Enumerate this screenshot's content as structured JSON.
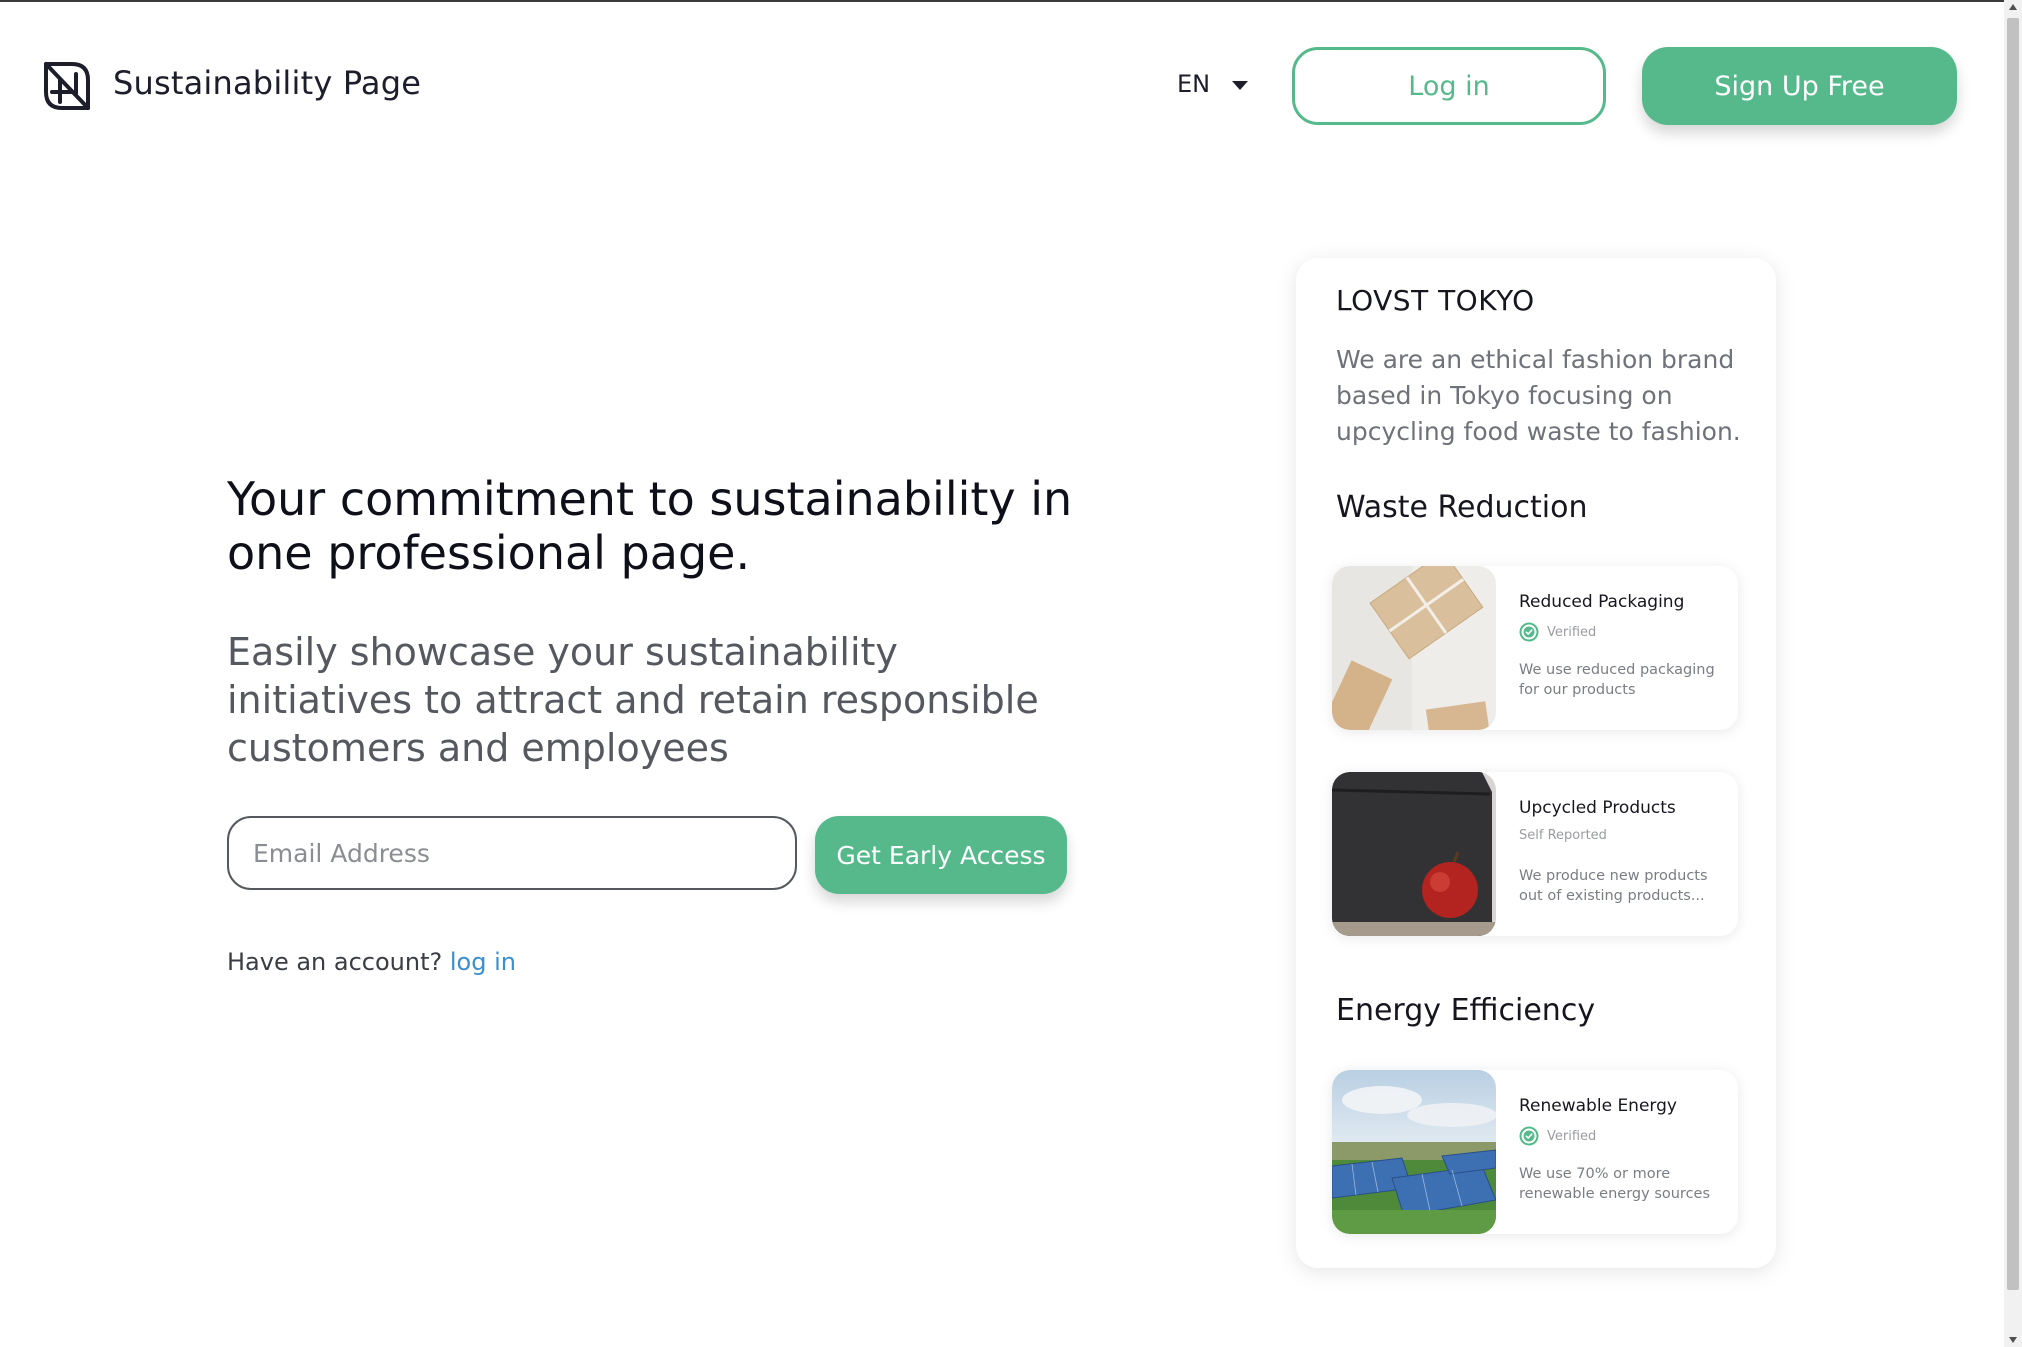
{
  "header": {
    "brand": "Sustainability Page",
    "logo_icon": "leaf-logo-icon",
    "language": "EN",
    "login_label": "Log in",
    "signup_label": "Sign Up Free"
  },
  "hero": {
    "headline": "Your commitment to sustainability in one professional page.",
    "subheadline": "Easily showcase your sustainability initiatives to attract and retain responsible customers and employees",
    "email_placeholder": "Email Address",
    "cta_label": "Get Early Access",
    "account_prompt": "Have an account?",
    "account_link": "log in"
  },
  "preview": {
    "company_name": "LOVST TOKYO",
    "company_description": "We are an ethical fashion brand based in Tokyo focusing on upcycling food waste to fashion.",
    "sections": [
      {
        "title": "Waste Reduction",
        "items": [
          {
            "title": "Reduced Packaging",
            "status": "Verified",
            "description": "We use reduced packaging for our products",
            "image_icon": "package-image"
          },
          {
            "title": "Upcycled Products",
            "status": "Self Reported",
            "description": "We produce new products out of existing products...",
            "image_icon": "bag-apple-image"
          }
        ]
      },
      {
        "title": "Energy Efficiency",
        "items": [
          {
            "title": "Renewable Energy",
            "status": "Verified",
            "description": "We use 70% or more renewable energy sources",
            "image_icon": "solar-panels-image"
          }
        ]
      }
    ]
  },
  "colors": {
    "accent": "#55b98b",
    "link": "#3a8fd0",
    "text_dark": "#0f0f1a",
    "text_muted": "#55585f"
  }
}
